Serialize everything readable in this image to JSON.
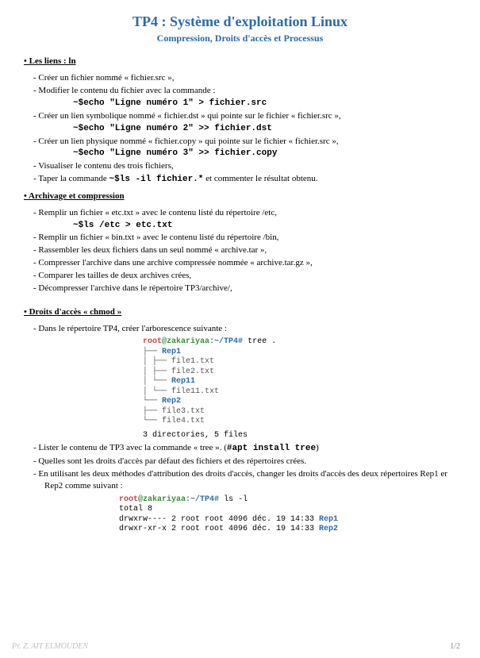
{
  "title": "TP4 : Système d'exploitation Linux",
  "subtitle": "Compression, Droits d'accès et Processus",
  "sec1": {
    "heading": "Les liens : ln",
    "i1": "Créer un fichier nommé « fichier.src »,",
    "i2": "Modifier le contenu du fichier avec la commande :",
    "c2": "~$echo \"Ligne numéro 1\" > fichier.src",
    "i3": "Créer un lien symbolique nommé « fichier.dst » qui pointe sur le fichier « fichier.src »,",
    "c3": "~$echo \"Ligne numéro 2\" >> fichier.dst",
    "i4": "Créer un lien physique nommé « fichier.copy » qui pointe sur le fichier « fichier.src »,",
    "c4": "~$echo \"Ligne numéro 3\" >> fichier.copy",
    "i5": "Visualiser le contenu des trois fichiers,",
    "i6a": "Taper la commande ",
    "i6cmd": "~$ls -il fichier.*",
    "i6b": "  et commenter le résultat obtenu."
  },
  "sec2": {
    "heading": "Archivage et compression",
    "i1": "Remplir un fichier « etc.txt » avec le contenu listé du répertoire /etc,",
    "c1": "~$ls /etc > etc.txt",
    "i2": "Remplir un fichier « bin.txt » avec le contenu listé du répertoire /bin,",
    "i3": "Rassembler les deux fichiers dans un seul nommé « archive.tar »,",
    "i4": "Compresser l'archive dans une archive compressée nommée « archive.tar.gz »,",
    "i5": "Comparer les tailles de deux archives crées,",
    "i6": "Décompresser l'archive dans le répertoire TP3/archive/,"
  },
  "sec3": {
    "heading": "Droits d'accès « chmod »",
    "i1": "Dans le répertoire TP4, créer l'arborescence suivante :",
    "tree": {
      "prompt_user": "root",
      "prompt_at": "@",
      "prompt_host": "zakariyaa",
      "prompt_path": ":~/TP4#",
      "prompt_cmd": " tree .",
      "l1": "├── ",
      "d1": "Rep1",
      "l2": "│   ├── file1.txt",
      "l3": "│   ├── file2.txt",
      "l4": "│   └── ",
      "d4": "Rep11",
      "l5": "│       └── file11.txt",
      "l6": "└── ",
      "d6": "Rep2",
      "l7": "    ├── file3.txt",
      "l8": "    └── file4.txt",
      "summary": "3 directories, 5 files"
    },
    "i2a": "Lister le contenu de TP3 avec la commande « tree ». (",
    "i2cmd": "#apt install tree",
    "i2b": ")",
    "i3": "Quelles sont les droits d'accès par défaut des fichiers et des répertoires crées.",
    "i4": "En utilisant les deux méthodes d'attribution des droits d'accès, changer les droits d'accès des deux répertoires Rep1 er Rep2 comme suivant :",
    "ls": {
      "prompt_user": "root",
      "prompt_at": "@",
      "prompt_host": "zakariyaa",
      "prompt_path": ":~/TP4#",
      "prompt_cmd": " ls -l",
      "l1": "total 8",
      "l2a": "drwxrw---- 2 root root 4096 déc.  19 14:33 ",
      "l2d": "Rep1",
      "l3a": "drwxr-xr-x 2 root root 4096 déc.  19 14:33 ",
      "l3d": "Rep2"
    }
  },
  "footer": {
    "left": "Pr. Z. AIT ELMOUDEN",
    "right": "1/2"
  }
}
